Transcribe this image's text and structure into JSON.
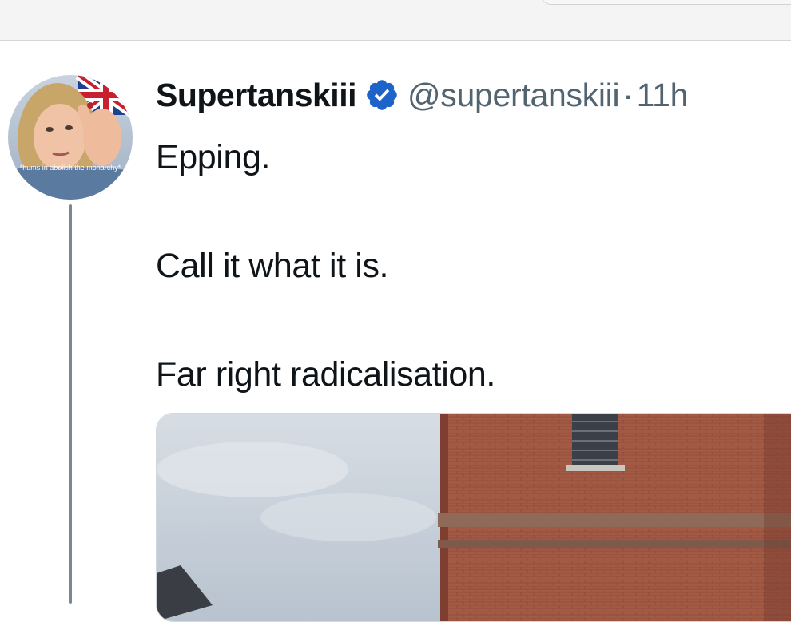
{
  "tweet": {
    "display_name": "Supertanskiii",
    "handle": "@supertanskiii",
    "separator": "·",
    "time": "11h",
    "text_lines": [
      "Epping.",
      "",
      "Call it what it is.",
      "",
      "Far right radicalisation."
    ],
    "avatar_caption": "*hums in abolish the monarchy*",
    "badge_icon": "verified-badge-icon",
    "colors": {
      "name": "#0f1419",
      "muted": "#536471",
      "badge": "#1d9bf0",
      "thread_line": "#7b8794"
    }
  }
}
